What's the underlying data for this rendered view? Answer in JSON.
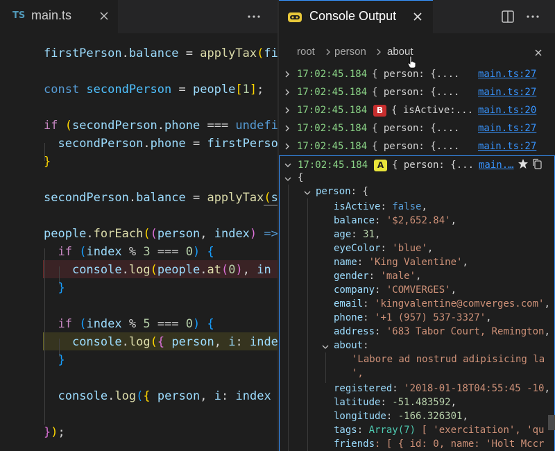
{
  "editor": {
    "tab": {
      "lang_badge": "TS",
      "filename": "main.ts"
    },
    "code_lines": [
      {
        "tokens": [
          [
            "v",
            "firstPerson"
          ],
          [
            "p",
            "."
          ],
          [
            "v",
            "balance"
          ],
          [
            "p",
            " = "
          ],
          [
            "f",
            "applyTax"
          ],
          [
            "b1",
            "("
          ],
          [
            "v",
            "fi"
          ]
        ]
      },
      {
        "tokens": []
      },
      {
        "tokens": [
          [
            "k",
            "const "
          ],
          [
            "c",
            "secondPerson"
          ],
          [
            "p",
            " = "
          ],
          [
            "v",
            "people"
          ],
          [
            "b1",
            "["
          ],
          [
            "n",
            "1"
          ],
          [
            "b1",
            "]"
          ],
          [
            "p",
            ";"
          ]
        ]
      },
      {
        "tokens": []
      },
      {
        "tokens": [
          [
            "kw",
            "if "
          ],
          [
            "b1",
            "("
          ],
          [
            "v",
            "secondPerson"
          ],
          [
            "p",
            "."
          ],
          [
            "v",
            "phone"
          ],
          [
            "p",
            " === "
          ],
          [
            "k",
            "undefi"
          ]
        ]
      },
      {
        "tokens": [
          [
            "p",
            "  "
          ],
          [
            "v",
            "secondPerson"
          ],
          [
            "p",
            "."
          ],
          [
            "v",
            "phone"
          ],
          [
            "p",
            " = "
          ],
          [
            "v",
            "firstPerso"
          ]
        ]
      },
      {
        "tokens": [
          [
            "b1",
            "}"
          ]
        ]
      },
      {
        "tokens": []
      },
      {
        "tokens": [
          [
            "v",
            "secondPerson"
          ],
          [
            "p",
            "."
          ],
          [
            "v",
            "balance"
          ],
          [
            "p",
            " = "
          ],
          [
            "f",
            "applyTax"
          ],
          [
            "b1",
            "("
          ],
          [
            "v",
            "s"
          ]
        ]
      },
      {
        "tokens": []
      },
      {
        "tokens": [
          [
            "v",
            "people"
          ],
          [
            "p",
            "."
          ],
          [
            "f",
            "forEach"
          ],
          [
            "b1",
            "("
          ],
          [
            "b2",
            "("
          ],
          [
            "v",
            "person"
          ],
          [
            "p",
            ", "
          ],
          [
            "v",
            "index"
          ],
          [
            "b2",
            ")"
          ],
          [
            "k",
            " =>"
          ]
        ]
      },
      {
        "tokens": [
          [
            "p",
            "  "
          ],
          [
            "kw",
            "if "
          ],
          [
            "b3",
            "("
          ],
          [
            "v",
            "index"
          ],
          [
            "p",
            " % "
          ],
          [
            "n",
            "3"
          ],
          [
            "p",
            " === "
          ],
          [
            "n",
            "0"
          ],
          [
            "b3",
            ")"
          ],
          [
            "p",
            " "
          ],
          [
            "b3",
            "{"
          ]
        ]
      },
      {
        "tokens": [
          [
            "p",
            "    "
          ],
          [
            "v",
            "console"
          ],
          [
            "p",
            "."
          ],
          [
            "f",
            "log"
          ],
          [
            "b1",
            "("
          ],
          [
            "v",
            "people"
          ],
          [
            "p",
            "."
          ],
          [
            "f",
            "at"
          ],
          [
            "b2",
            "("
          ],
          [
            "n",
            "0"
          ],
          [
            "b2",
            ")"
          ],
          [
            "p",
            ", "
          ],
          [
            "v",
            "in"
          ]
        ]
      },
      {
        "tokens": [
          [
            "p",
            "  "
          ],
          [
            "b3",
            "}"
          ]
        ]
      },
      {
        "tokens": []
      },
      {
        "tokens": [
          [
            "p",
            "  "
          ],
          [
            "kw",
            "if "
          ],
          [
            "b3",
            "("
          ],
          [
            "v",
            "index"
          ],
          [
            "p",
            " % "
          ],
          [
            "n",
            "5"
          ],
          [
            "p",
            " === "
          ],
          [
            "n",
            "0"
          ],
          [
            "b3",
            ")"
          ],
          [
            "p",
            " "
          ],
          [
            "b3",
            "{"
          ]
        ]
      },
      {
        "tokens": [
          [
            "p",
            "    "
          ],
          [
            "v",
            "console"
          ],
          [
            "p",
            "."
          ],
          [
            "f",
            "log"
          ],
          [
            "b1",
            "("
          ],
          [
            "b2",
            "{"
          ],
          [
            "p",
            " "
          ],
          [
            "v",
            "person"
          ],
          [
            "p",
            ", "
          ],
          [
            "v",
            "i"
          ],
          [
            "p",
            ": "
          ],
          [
            "v",
            "inde"
          ]
        ]
      },
      {
        "tokens": [
          [
            "p",
            "  "
          ],
          [
            "b3",
            "}"
          ]
        ]
      },
      {
        "tokens": []
      },
      {
        "tokens": [
          [
            "p",
            "  "
          ],
          [
            "v",
            "console"
          ],
          [
            "p",
            "."
          ],
          [
            "f",
            "log"
          ],
          [
            "b3",
            "("
          ],
          [
            "b1",
            "{"
          ],
          [
            "p",
            " "
          ],
          [
            "v",
            "person"
          ],
          [
            "p",
            ", "
          ],
          [
            "v",
            "i"
          ],
          [
            "p",
            ": "
          ],
          [
            "v",
            "index"
          ]
        ]
      },
      {
        "tokens": []
      },
      {
        "tokens": [
          [
            "b2",
            "}"
          ],
          [
            "b1",
            ")"
          ],
          [
            "p",
            ";"
          ]
        ]
      }
    ]
  },
  "panel": {
    "title": "Console Output",
    "breadcrumbs": [
      "root",
      "person",
      "about"
    ],
    "logs": [
      {
        "time": "17:02:45.184",
        "badge": "",
        "summary": "{ person: {....",
        "source": "main.ts:27"
      },
      {
        "time": "17:02:45.184",
        "badge": "",
        "summary": "{ person: {....",
        "source": "main.ts:27"
      },
      {
        "time": "17:02:45.184",
        "badge": "B",
        "summary": "{ isActive:...",
        "source": "main.ts:20"
      },
      {
        "time": "17:02:45.184",
        "badge": "",
        "summary": "{ person: {....",
        "source": "main.ts:27"
      },
      {
        "time": "17:02:45.184",
        "badge": "",
        "summary": "{ person: {....",
        "source": "main.ts:27"
      },
      {
        "time": "17:02:45.184",
        "badge": "A",
        "summary": "{ person: {...",
        "source": "main.…"
      }
    ],
    "tree": {
      "open_brace": "{",
      "person_key": "person",
      "person_open": ": {",
      "props": [
        {
          "key": "isActive",
          "value": "false",
          "type": "bool"
        },
        {
          "key": "balance",
          "value": "'$2,652.84'",
          "type": "str"
        },
        {
          "key": "age",
          "value": "31",
          "type": "num"
        },
        {
          "key": "eyeColor",
          "value": "'blue'",
          "type": "str"
        },
        {
          "key": "name",
          "value": "'King Valentine'",
          "type": "str"
        },
        {
          "key": "gender",
          "value": "'male'",
          "type": "str"
        },
        {
          "key": "company",
          "value": "'COMVERGES'",
          "type": "str"
        },
        {
          "key": "email",
          "value": "'kingvalentine@comverges.com'",
          "type": "str"
        },
        {
          "key": "phone",
          "value": "'+1 (957) 537-3327'",
          "type": "str"
        },
        {
          "key": "address",
          "value": "'683 Tabor Court, Remington",
          "type": "str"
        }
      ],
      "about_key": "about",
      "about_line1": "'Labore ad nostrud adipisicing la",
      "about_line2": "',",
      "props2": [
        {
          "key": "registered",
          "value": "'2018-01-18T04:55:45 -10",
          "type": "str"
        },
        {
          "key": "latitude",
          "value": "-51.483592",
          "type": "num"
        },
        {
          "key": "longitude",
          "value": "-166.326301",
          "type": "num"
        }
      ],
      "tags_key": "tags",
      "tags_type": "Array(7)",
      "tags_rest": " [ 'exercitation', 'qu",
      "friends_key": "friends",
      "friends_rest": ": [ { id: 0, name: 'Holt Mccr"
    }
  }
}
